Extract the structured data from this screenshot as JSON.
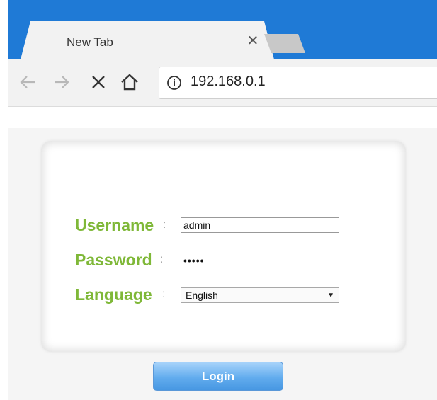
{
  "browser": {
    "tab_title": "New Tab",
    "tab_close": "✕",
    "address": "192.168.0.1"
  },
  "icons": {
    "back": "back-arrow-icon",
    "forward": "forward-arrow-icon",
    "stop": "stop-icon",
    "home": "home-icon",
    "info": "info-icon",
    "dropdown": "chevron-down-icon"
  },
  "colors": {
    "tabstrip": "#1f7ad6",
    "label_green": "#7fb838",
    "button_blue": "#62acee"
  },
  "form": {
    "username_label": "Username",
    "password_label": "Password",
    "language_label": "Language",
    "colon": ":",
    "username_value": "admin",
    "password_value": "•••••",
    "language_value": "English",
    "dropdown_arrow": "▼",
    "login_label": "Login"
  }
}
